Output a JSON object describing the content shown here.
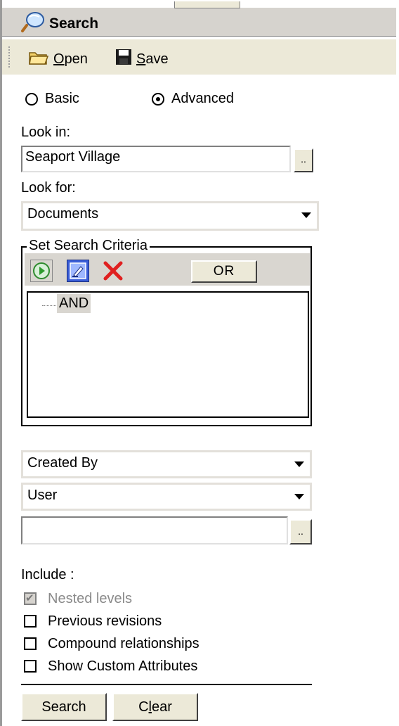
{
  "window": {
    "title": "Search",
    "icon": "search-magnifier-icon"
  },
  "toolbar": {
    "open_label": "Open",
    "open_accel": "O",
    "open_rest": "pen",
    "save_label": "Save",
    "save_accel": "S",
    "save_rest": "ave"
  },
  "mode": {
    "basic_label": "Basic",
    "advanced_label": "Advanced",
    "selected": "Advanced"
  },
  "look_in": {
    "label": "Look in:",
    "value": "Seaport Village",
    "browse_label": ".."
  },
  "look_for": {
    "label": "Look for:",
    "value": "Documents"
  },
  "criteria": {
    "legend": "Set Search Criteria",
    "icons": [
      "run-icon",
      "edit-criteria-icon",
      "delete-icon"
    ],
    "or_label": "OR",
    "tree_root": "AND"
  },
  "attribute_select": {
    "value": "Created By"
  },
  "type_select": {
    "value": "User"
  },
  "value_field": {
    "value": "",
    "browse_label": ".."
  },
  "include": {
    "label": "Include :",
    "options": [
      {
        "label": "Nested levels",
        "checked": true,
        "disabled": true
      },
      {
        "label": "Previous revisions",
        "checked": false,
        "disabled": false
      },
      {
        "label": "Compound relationships",
        "checked": false,
        "disabled": false
      },
      {
        "label": "Show Custom Attributes",
        "checked": false,
        "disabled": false
      }
    ]
  },
  "actions": {
    "search_label": "Search",
    "clear_label": "Clear",
    "clear_accel": "l",
    "clear_pre": "C",
    "clear_post": "ear"
  },
  "colors": {
    "panel": "#d6d3ce",
    "toolbar": "#ece9d8",
    "criteria_bar": "#d9d6d0"
  }
}
